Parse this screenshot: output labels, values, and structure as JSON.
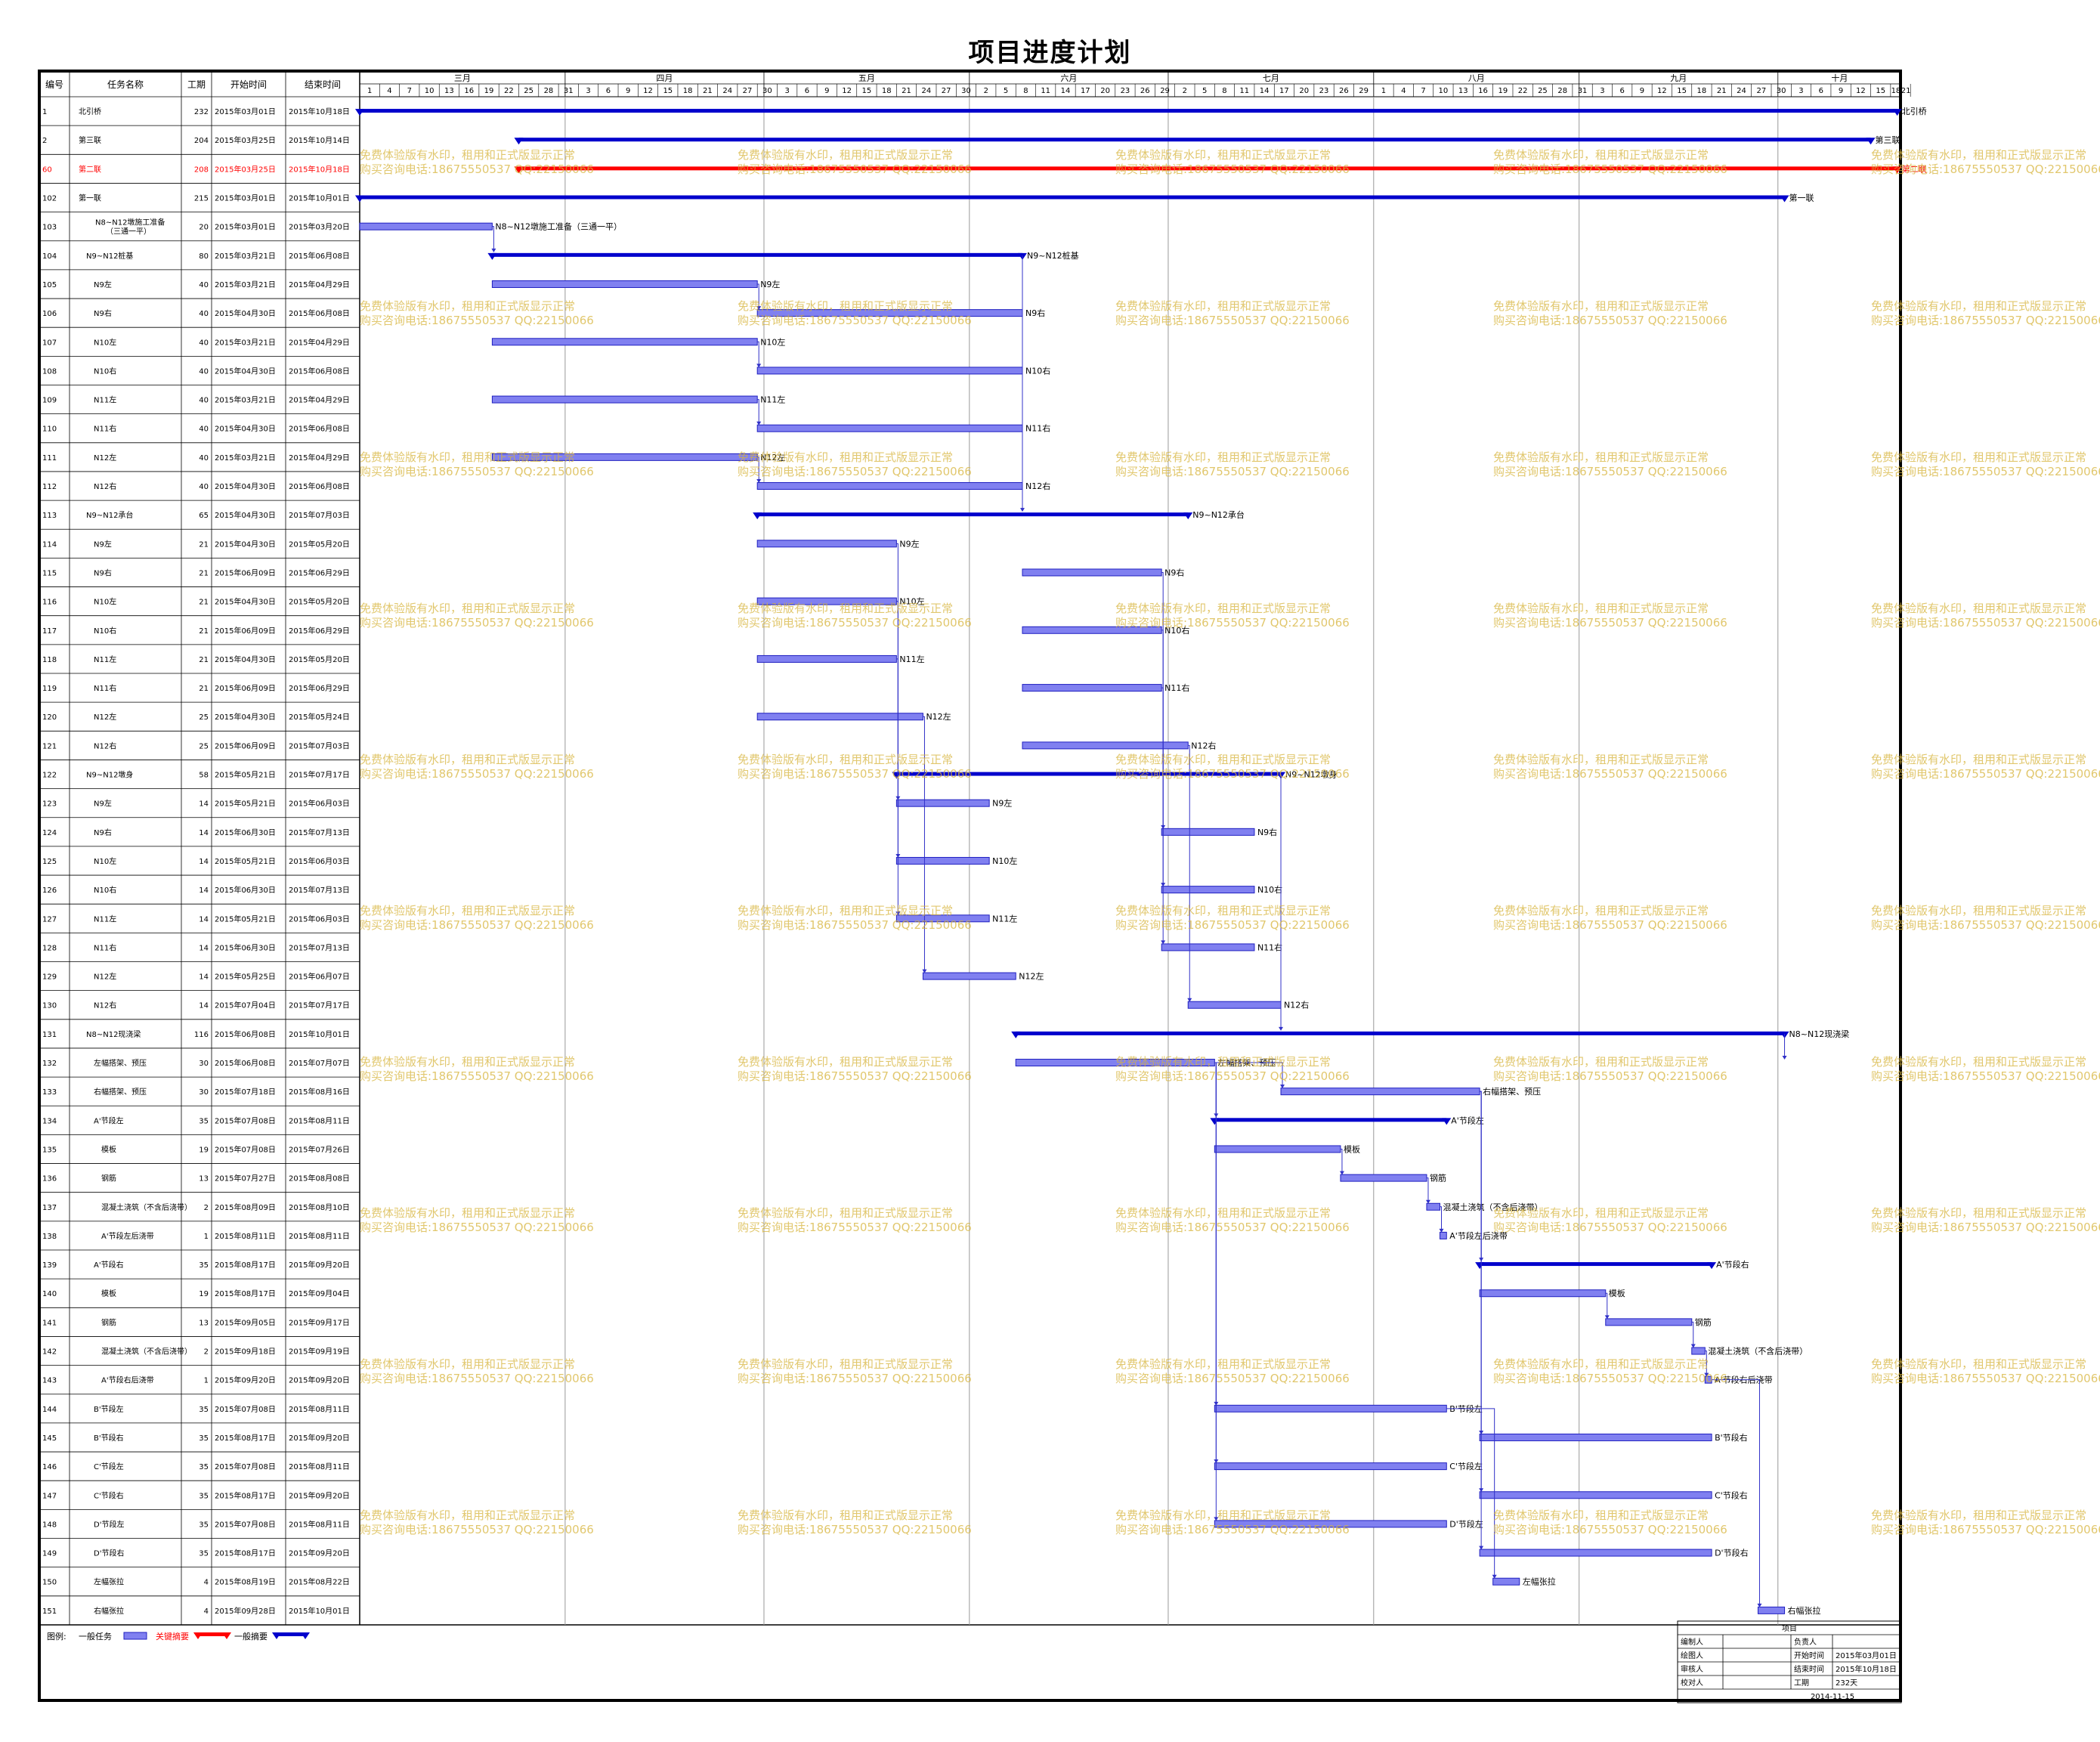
{
  "title": "项目进度计划",
  "columns": {
    "id": "编号",
    "name": "任务名称",
    "duration": "工期",
    "start": "开始时间",
    "end": "结束时间"
  },
  "months": [
    {
      "label": "三月",
      "start": "2015-03-01"
    },
    {
      "label": "四月",
      "start": "2015-04-01"
    },
    {
      "label": "五月",
      "start": "2015-05-01"
    },
    {
      "label": "六月",
      "start": "2015-06-01"
    },
    {
      "label": "七月",
      "start": "2015-07-01"
    },
    {
      "label": "八月",
      "start": "2015-08-01"
    },
    {
      "label": "九月",
      "start": "2015-09-01"
    },
    {
      "label": "十月",
      "start": "2015-10-01"
    }
  ],
  "day_ticks": [
    "1",
    "4",
    "7",
    "10",
    "13",
    "16",
    "19",
    "22",
    "25",
    "28",
    "31",
    "3",
    "6",
    "9",
    "12",
    "15",
    "18",
    "21",
    "24",
    "27",
    "30",
    "3",
    "6",
    "9",
    "12",
    "15",
    "18",
    "21",
    "24",
    "27",
    "30",
    "2",
    "5",
    "8",
    "11",
    "14",
    "17",
    "20",
    "23",
    "26",
    "29",
    "2",
    "5",
    "8",
    "11",
    "14",
    "17",
    "20",
    "23",
    "26",
    "29",
    "1",
    "4",
    "7",
    "10",
    "13",
    "16",
    "19",
    "22",
    "25",
    "28",
    "31",
    "3",
    "6",
    "9",
    "12",
    "15",
    "18",
    "21",
    "24",
    "27",
    "30",
    "3",
    "6",
    "9",
    "12",
    "15",
    "18",
    "21"
  ],
  "tasks": [
    {
      "id": "1",
      "name": "北引桥",
      "duration": "232",
      "start": "2015年03月01日",
      "end": "2015年10月18日",
      "s": "2015-03-01",
      "e": "2015-10-18",
      "type": "summary",
      "label": "北引桥",
      "indent": 0
    },
    {
      "id": "2",
      "name": "第三联",
      "duration": "204",
      "start": "2015年03月25日",
      "end": "2015年10月14日",
      "s": "2015-03-25",
      "e": "2015-10-14",
      "type": "summary",
      "label": "第三联",
      "indent": 0
    },
    {
      "id": "60",
      "name": "第二联",
      "duration": "208",
      "start": "2015年03月25日",
      "end": "2015年10月18日",
      "s": "2015-03-25",
      "e": "2015-10-18",
      "type": "critical",
      "label": "第二联",
      "indent": 0
    },
    {
      "id": "102",
      "name": "第一联",
      "duration": "215",
      "start": "2015年03月01日",
      "end": "2015年10月01日",
      "s": "2015-03-01",
      "e": "2015-10-01",
      "type": "summary",
      "label": "第一联",
      "indent": 0
    },
    {
      "id": "103",
      "name": "N8~N12墩施工准备（三通一平）",
      "duration": "20",
      "start": "2015年03月01日",
      "end": "2015年03月20日",
      "s": "2015-03-01",
      "e": "2015-03-20",
      "type": "task",
      "label": "N8~N12墩施工准备（三通一平）",
      "indent": 1
    },
    {
      "id": "104",
      "name": "N9~N12桩基",
      "duration": "80",
      "start": "2015年03月21日",
      "end": "2015年06月08日",
      "s": "2015-03-21",
      "e": "2015-06-08",
      "type": "summary",
      "label": "N9~N12桩基",
      "indent": 1
    },
    {
      "id": "105",
      "name": "N9左",
      "duration": "40",
      "start": "2015年03月21日",
      "end": "2015年04月29日",
      "s": "2015-03-21",
      "e": "2015-04-29",
      "type": "task",
      "label": "N9左",
      "indent": 2
    },
    {
      "id": "106",
      "name": "N9右",
      "duration": "40",
      "start": "2015年04月30日",
      "end": "2015年06月08日",
      "s": "2015-04-30",
      "e": "2015-06-08",
      "type": "task",
      "label": "N9右",
      "indent": 2
    },
    {
      "id": "107",
      "name": "N10左",
      "duration": "40",
      "start": "2015年03月21日",
      "end": "2015年04月29日",
      "s": "2015-03-21",
      "e": "2015-04-29",
      "type": "task",
      "label": "N10左",
      "indent": 2
    },
    {
      "id": "108",
      "name": "N10右",
      "duration": "40",
      "start": "2015年04月30日",
      "end": "2015年06月08日",
      "s": "2015-04-30",
      "e": "2015-06-08",
      "type": "task",
      "label": "N10右",
      "indent": 2
    },
    {
      "id": "109",
      "name": "N11左",
      "duration": "40",
      "start": "2015年03月21日",
      "end": "2015年04月29日",
      "s": "2015-03-21",
      "e": "2015-04-29",
      "type": "task",
      "label": "N11左",
      "indent": 2
    },
    {
      "id": "110",
      "name": "N11右",
      "duration": "40",
      "start": "2015年04月30日",
      "end": "2015年06月08日",
      "s": "2015-04-30",
      "e": "2015-06-08",
      "type": "task",
      "label": "N11右",
      "indent": 2
    },
    {
      "id": "111",
      "name": "N12左",
      "duration": "40",
      "start": "2015年03月21日",
      "end": "2015年04月29日",
      "s": "2015-03-21",
      "e": "2015-04-29",
      "type": "task",
      "label": "N12左",
      "indent": 2
    },
    {
      "id": "112",
      "name": "N12右",
      "duration": "40",
      "start": "2015年04月30日",
      "end": "2015年06月08日",
      "s": "2015-04-30",
      "e": "2015-06-08",
      "type": "task",
      "label": "N12右",
      "indent": 2
    },
    {
      "id": "113",
      "name": "N9~N12承台",
      "duration": "65",
      "start": "2015年04月30日",
      "end": "2015年07月03日",
      "s": "2015-04-30",
      "e": "2015-07-03",
      "type": "summary",
      "label": "N9~N12承台",
      "indent": 1
    },
    {
      "id": "114",
      "name": "N9左",
      "duration": "21",
      "start": "2015年04月30日",
      "end": "2015年05月20日",
      "s": "2015-04-30",
      "e": "2015-05-20",
      "type": "task",
      "label": "N9左",
      "indent": 2
    },
    {
      "id": "115",
      "name": "N9右",
      "duration": "21",
      "start": "2015年06月09日",
      "end": "2015年06月29日",
      "s": "2015-06-09",
      "e": "2015-06-29",
      "type": "task",
      "label": "N9右",
      "indent": 2
    },
    {
      "id": "116",
      "name": "N10左",
      "duration": "21",
      "start": "2015年04月30日",
      "end": "2015年05月20日",
      "s": "2015-04-30",
      "e": "2015-05-20",
      "type": "task",
      "label": "N10左",
      "indent": 2
    },
    {
      "id": "117",
      "name": "N10右",
      "duration": "21",
      "start": "2015年06月09日",
      "end": "2015年06月29日",
      "s": "2015-06-09",
      "e": "2015-06-29",
      "type": "task",
      "label": "N10右",
      "indent": 2
    },
    {
      "id": "118",
      "name": "N11左",
      "duration": "21",
      "start": "2015年04月30日",
      "end": "2015年05月20日",
      "s": "2015-04-30",
      "e": "2015-05-20",
      "type": "task",
      "label": "N11左",
      "indent": 2
    },
    {
      "id": "119",
      "name": "N11右",
      "duration": "21",
      "start": "2015年06月09日",
      "end": "2015年06月29日",
      "s": "2015-06-09",
      "e": "2015-06-29",
      "type": "task",
      "label": "N11右",
      "indent": 2
    },
    {
      "id": "120",
      "name": "N12左",
      "duration": "25",
      "start": "2015年04月30日",
      "end": "2015年05月24日",
      "s": "2015-04-30",
      "e": "2015-05-24",
      "type": "task",
      "label": "N12左",
      "indent": 2
    },
    {
      "id": "121",
      "name": "N12右",
      "duration": "25",
      "start": "2015年06月09日",
      "end": "2015年07月03日",
      "s": "2015-06-09",
      "e": "2015-07-03",
      "type": "task",
      "label": "N12右",
      "indent": 2
    },
    {
      "id": "122",
      "name": "N9~N12墩身",
      "duration": "58",
      "start": "2015年05月21日",
      "end": "2015年07月17日",
      "s": "2015-05-21",
      "e": "2015-07-17",
      "type": "summary",
      "label": "N9~N12墩身",
      "indent": 1
    },
    {
      "id": "123",
      "name": "N9左",
      "duration": "14",
      "start": "2015年05月21日",
      "end": "2015年06月03日",
      "s": "2015-05-21",
      "e": "2015-06-03",
      "type": "task",
      "label": "N9左",
      "indent": 2
    },
    {
      "id": "124",
      "name": "N9右",
      "duration": "14",
      "start": "2015年06月30日",
      "end": "2015年07月13日",
      "s": "2015-06-30",
      "e": "2015-07-13",
      "type": "task",
      "label": "N9右",
      "indent": 2
    },
    {
      "id": "125",
      "name": "N10左",
      "duration": "14",
      "start": "2015年05月21日",
      "end": "2015年06月03日",
      "s": "2015-05-21",
      "e": "2015-06-03",
      "type": "task",
      "label": "N10左",
      "indent": 2
    },
    {
      "id": "126",
      "name": "N10右",
      "duration": "14",
      "start": "2015年06月30日",
      "end": "2015年07月13日",
      "s": "2015-06-30",
      "e": "2015-07-13",
      "type": "task",
      "label": "N10右",
      "indent": 2
    },
    {
      "id": "127",
      "name": "N11左",
      "duration": "14",
      "start": "2015年05月21日",
      "end": "2015年06月03日",
      "s": "2015-05-21",
      "e": "2015-06-03",
      "type": "task",
      "label": "N11左",
      "indent": 2
    },
    {
      "id": "128",
      "name": "N11右",
      "duration": "14",
      "start": "2015年06月30日",
      "end": "2015年07月13日",
      "s": "2015-06-30",
      "e": "2015-07-13",
      "type": "task",
      "label": "N11右",
      "indent": 2
    },
    {
      "id": "129",
      "name": "N12左",
      "duration": "14",
      "start": "2015年05月25日",
      "end": "2015年06月07日",
      "s": "2015-05-25",
      "e": "2015-06-07",
      "type": "task",
      "label": "N12左",
      "indent": 2
    },
    {
      "id": "130",
      "name": "N12右",
      "duration": "14",
      "start": "2015年07月04日",
      "end": "2015年07月17日",
      "s": "2015-07-04",
      "e": "2015-07-17",
      "type": "task",
      "label": "N12右",
      "indent": 2
    },
    {
      "id": "131",
      "name": "N8~N12现浇梁",
      "duration": "116",
      "start": "2015年06月08日",
      "end": "2015年10月01日",
      "s": "2015-06-08",
      "e": "2015-10-01",
      "type": "summary",
      "label": "N8~N12现浇梁",
      "indent": 1
    },
    {
      "id": "132",
      "name": "左幅搭架、预压",
      "duration": "30",
      "start": "2015年06月08日",
      "end": "2015年07月07日",
      "s": "2015-06-08",
      "e": "2015-07-07",
      "type": "task",
      "label": "左幅搭架、预压",
      "indent": 2
    },
    {
      "id": "133",
      "name": "右幅搭架、预压",
      "duration": "30",
      "start": "2015年07月18日",
      "end": "2015年08月16日",
      "s": "2015-07-18",
      "e": "2015-08-16",
      "type": "task",
      "label": "右幅搭架、预压",
      "indent": 2
    },
    {
      "id": "134",
      "name": "A'节段左",
      "duration": "35",
      "start": "2015年07月08日",
      "end": "2015年08月11日",
      "s": "2015-07-08",
      "e": "2015-08-11",
      "type": "summary",
      "label": "A'节段左",
      "indent": 2
    },
    {
      "id": "135",
      "name": "模板",
      "duration": "19",
      "start": "2015年07月08日",
      "end": "2015年07月26日",
      "s": "2015-07-08",
      "e": "2015-07-26",
      "type": "task",
      "label": "模板",
      "indent": 3
    },
    {
      "id": "136",
      "name": "钢筋",
      "duration": "13",
      "start": "2015年07月27日",
      "end": "2015年08月08日",
      "s": "2015-07-27",
      "e": "2015-08-08",
      "type": "task",
      "label": "钢筋",
      "indent": 3
    },
    {
      "id": "137",
      "name": "混凝土浇筑（不含后浇带）",
      "duration": "2",
      "start": "2015年08月09日",
      "end": "2015年08月10日",
      "s": "2015-08-09",
      "e": "2015-08-10",
      "type": "task",
      "label": "混凝土浇筑（不含后浇带）",
      "indent": 3
    },
    {
      "id": "138",
      "name": "A'节段左后浇带",
      "duration": "1",
      "start": "2015年08月11日",
      "end": "2015年08月11日",
      "s": "2015-08-11",
      "e": "2015-08-11",
      "type": "task",
      "label": "A'节段左后浇带",
      "indent": 3
    },
    {
      "id": "139",
      "name": "A'节段右",
      "duration": "35",
      "start": "2015年08月17日",
      "end": "2015年09月20日",
      "s": "2015-08-17",
      "e": "2015-09-20",
      "type": "summary",
      "label": "A'节段右",
      "indent": 2
    },
    {
      "id": "140",
      "name": "模板",
      "duration": "19",
      "start": "2015年08月17日",
      "end": "2015年09月04日",
      "s": "2015-08-17",
      "e": "2015-09-04",
      "type": "task",
      "label": "模板",
      "indent": 3
    },
    {
      "id": "141",
      "name": "钢筋",
      "duration": "13",
      "start": "2015年09月05日",
      "end": "2015年09月17日",
      "s": "2015-09-05",
      "e": "2015-09-17",
      "type": "task",
      "label": "钢筋",
      "indent": 3
    },
    {
      "id": "142",
      "name": "混凝土浇筑（不含后浇带）",
      "duration": "2",
      "start": "2015年09月18日",
      "end": "2015年09月19日",
      "s": "2015-09-18",
      "e": "2015-09-19",
      "type": "task",
      "label": "混凝土浇筑（不含后浇带）",
      "indent": 3
    },
    {
      "id": "143",
      "name": "A'节段右后浇带",
      "duration": "1",
      "start": "2015年09月20日",
      "end": "2015年09月20日",
      "s": "2015-09-20",
      "e": "2015-09-20",
      "type": "task",
      "label": "A'节段右后浇带",
      "indent": 3
    },
    {
      "id": "144",
      "name": "B'节段左",
      "duration": "35",
      "start": "2015年07月08日",
      "end": "2015年08月11日",
      "s": "2015-07-08",
      "e": "2015-08-11",
      "type": "task",
      "label": "B'节段左",
      "indent": 2
    },
    {
      "id": "145",
      "name": "B'节段右",
      "duration": "35",
      "start": "2015年08月17日",
      "end": "2015年09月20日",
      "s": "2015-08-17",
      "e": "2015-09-20",
      "type": "task",
      "label": "B'节段右",
      "indent": 2
    },
    {
      "id": "146",
      "name": "C'节段左",
      "duration": "35",
      "start": "2015年07月08日",
      "end": "2015年08月11日",
      "s": "2015-07-08",
      "e": "2015-08-11",
      "type": "task",
      "label": "C'节段左",
      "indent": 2
    },
    {
      "id": "147",
      "name": "C'节段右",
      "duration": "35",
      "start": "2015年08月17日",
      "end": "2015年09月20日",
      "s": "2015-08-17",
      "e": "2015-09-20",
      "type": "task",
      "label": "C'节段右",
      "indent": 2
    },
    {
      "id": "148",
      "name": "D'节段左",
      "duration": "35",
      "start": "2015年07月08日",
      "end": "2015年08月11日",
      "s": "2015-07-08",
      "e": "2015-08-11",
      "type": "task",
      "label": "D'节段左",
      "indent": 2
    },
    {
      "id": "149",
      "name": "D'节段右",
      "duration": "35",
      "start": "2015年08月17日",
      "end": "2015年09月20日",
      "s": "2015-08-17",
      "e": "2015-09-20",
      "type": "task",
      "label": "D'节段右",
      "indent": 2
    },
    {
      "id": "150",
      "name": "左幅张拉",
      "duration": "4",
      "start": "2015年08月19日",
      "end": "2015年08月22日",
      "s": "2015-08-19",
      "e": "2015-08-22",
      "type": "task",
      "label": "左幅张拉",
      "indent": 2
    },
    {
      "id": "151",
      "name": "右幅张拉",
      "duration": "4",
      "start": "2015年09月28日",
      "end": "2015年10月01日",
      "s": "2015-09-28",
      "e": "2015-10-01",
      "type": "task",
      "label": "右幅张拉",
      "indent": 2
    }
  ],
  "legend": {
    "label": "图例:",
    "task": "一般任务",
    "critical": "关键摘要",
    "summary": "一般摘要"
  },
  "title_block": {
    "heading": "项目",
    "rows": [
      [
        "编制人",
        "",
        "负责人",
        ""
      ],
      [
        "绘图人",
        "",
        "开始时间",
        "2015年03月01日"
      ],
      [
        "审核人",
        "",
        "结束时间",
        "2015年10月18日"
      ],
      [
        "校对人",
        "",
        "工期",
        "232天"
      ]
    ],
    "date": "2014-11-15"
  },
  "watermark": [
    "免费体验版有水印，租用和正式版显示正常",
    "购买咨询电话:18675550537 QQ:22150066"
  ],
  "colors": {
    "task_fill": "#8080f0",
    "task_border": "#2020c0",
    "summary": "#0000cc",
    "critical": "#ff0000",
    "grid": "#000000",
    "link": "#3030c8",
    "watermark": "#d8b43c"
  }
}
